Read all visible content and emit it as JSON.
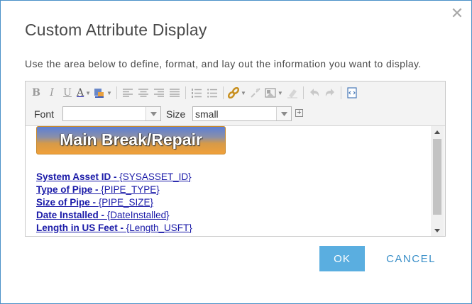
{
  "dialog": {
    "title": "Custom Attribute Display",
    "subtitle": "Use the area below to define, format, and lay out the information you want to display.",
    "close_icon": "close-icon"
  },
  "toolbar": {
    "bold_label": "B",
    "italic_label": "I",
    "underline_label": "U",
    "font_color_label": "A",
    "font_label": "Font",
    "font_value": "",
    "size_label": "Size",
    "size_value": "small",
    "icons": [
      "bold-icon",
      "italic-icon",
      "underline-icon",
      "font-color-icon",
      "highlight-color-icon",
      "align-left-icon",
      "align-center-icon",
      "align-right-icon",
      "justify-icon",
      "numbered-list-icon",
      "bullet-list-icon",
      "insert-link-icon",
      "unlink-icon",
      "insert-image-icon",
      "remove-format-icon",
      "undo-icon",
      "redo-icon",
      "view-source-icon",
      "expand-icon"
    ]
  },
  "content": {
    "banner_text": "Main Break/Repair",
    "fields": [
      {
        "name": "System Asset ID - ",
        "token": "{SYSASSET_ID}"
      },
      {
        "name": "Type of Pipe - ",
        "token": "{PIPE_TYPE}"
      },
      {
        "name": "Size of Pipe - ",
        "token": "{PIPE_SIZE}"
      },
      {
        "name": "Date Installed - ",
        "token": "{DateInstalled}"
      },
      {
        "name": "Length in US Feet - ",
        "token": "{Length_USFT}"
      }
    ]
  },
  "buttons": {
    "ok_label": "OK",
    "cancel_label": "CANCEL"
  },
  "colors": {
    "accent": "#5aaee0",
    "link": "#1a1aa8",
    "cancel_text": "#3a8fc8",
    "border": "#4a90c8"
  }
}
